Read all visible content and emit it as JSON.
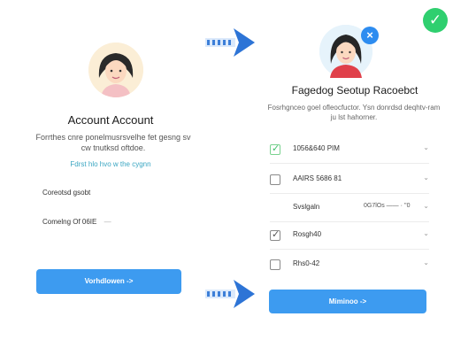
{
  "left": {
    "title": "Account Account",
    "subtitle": "Forrthes cnre ponelmusrsvelhe fet gesng sv cw tnutksd oftdoe.",
    "link": "Fdrst hlo hvo w the cygnn",
    "field1_label": "Coreotsd gsobt",
    "field2_label": "Comelng Of 06IE",
    "field2_dash": "—",
    "button_label": "Vorhdlowen ->"
  },
  "right": {
    "title": "Fagedog Seotup Racoebct",
    "subtitle": "Fosrhgnceo goel ofleocfuctor. Ysn donrdsd deqhtv-ram ju lst hahorner.",
    "rows": [
      {
        "label": "1056&640 PIM",
        "extra": "",
        "state": "checked"
      },
      {
        "label": "AAIRS 5686 81",
        "extra": "",
        "state": "unchecked"
      },
      {
        "label": "Svslgaln",
        "extra": "0G7lOs  —— ·  ''0",
        "state": "none"
      },
      {
        "label": "Rosgh40",
        "extra": "",
        "state": "partial"
      },
      {
        "label": "Rhs0-42",
        "extra": "",
        "state": "unchecked"
      }
    ],
    "button_label": "Miminoo ->"
  },
  "icons": {
    "close_badge": "×",
    "check_badge": "✓",
    "chevron": "⌄",
    "checked_mark": "✓",
    "partial_mark": "✓"
  },
  "colors": {
    "accent_blue": "#3d9bf0",
    "success_green": "#2fcf6f",
    "link_teal": "#3aa6c2"
  }
}
